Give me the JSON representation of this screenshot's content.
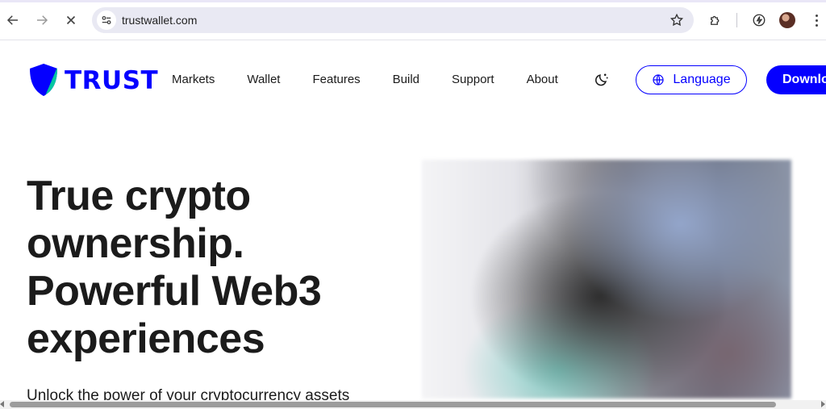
{
  "browser": {
    "url": "trustwallet.com",
    "icons": {
      "back": "arrow-left-icon",
      "forward": "arrow-right-icon",
      "stop": "close-icon",
      "site_info": "tune-icon",
      "bookmark": "star-icon",
      "extensions": "puzzle-icon",
      "performance": "lightning-icon",
      "menu": "kebab-icon"
    }
  },
  "site": {
    "brand": {
      "name": "TRUST",
      "color": "#0500ff"
    },
    "nav": [
      "Markets",
      "Wallet",
      "Features",
      "Build",
      "Support",
      "About"
    ],
    "theme_toggle_icon": "moon-icon",
    "language_label": "Language",
    "download_label": "Download"
  },
  "hero": {
    "title_lines": [
      "True crypto",
      "ownership.",
      "Powerful Web3",
      "experiences"
    ],
    "subtitle": "Unlock the power of your cryptocurrency assets"
  }
}
